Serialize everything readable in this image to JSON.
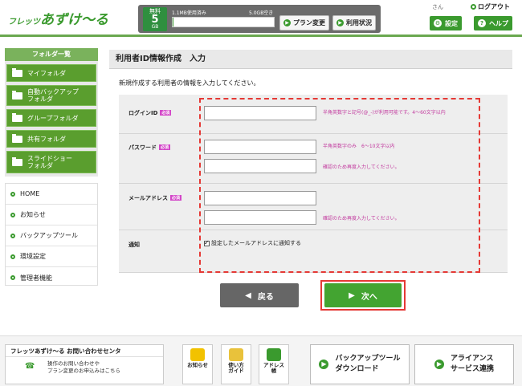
{
  "header": {
    "logo_small": "フレッツ",
    "logo_large": "あずけ〜る",
    "plan_badge": {
      "line1": "無料",
      "line2": "5",
      "line3": "GB"
    },
    "usage_used": "1.1MB使用済み",
    "usage_free": "5.0GB空き",
    "usage_fraction": 0.0002,
    "plan_change": "プラン変更",
    "usage_status": "利用状況",
    "user_suffix": "さん",
    "logout": "ログアウト",
    "settings": "設定",
    "help": "ヘルプ"
  },
  "sidebar": {
    "folder_title": "フォルダ一覧",
    "folders": [
      "マイフォルダ",
      "自動バックアップ\nフォルダ",
      "グループフォルダ",
      "共有フォルダ",
      "スライドショー\nフォルダ"
    ],
    "nav": [
      "HOME",
      "お知らせ",
      "バックアップツール",
      "環境設定",
      "管理者機能"
    ]
  },
  "main": {
    "title": "利用者ID情報作成　入力",
    "intro": "新規作成する利用者の情報を入力してください。",
    "fields": {
      "login_label": "ログインID",
      "password_label": "パスワード",
      "email_label": "メールアドレス",
      "notify_label": "通知",
      "required_badge": "必須",
      "login_hint": "半角英数字と記号(@_-)が利用可能です。4〜60文字以内",
      "password_hint": "半角英数字のみ　6〜10文字以内",
      "password_confirm_hint": "確認のため再度入力してください。",
      "email_confirm_hint": "確認のため再度入力してください。",
      "notify_text": "設定したメールアドレスに通知する"
    },
    "back_label": "戻る",
    "next_label": "次へ"
  },
  "footer": {
    "contact_title": "フレッツあずけ〜る お問い合わせセンタ",
    "contact_line1": "操作のお問い合わせや",
    "contact_line2": "プラン変更のお申込みはこちら",
    "tile_news": "お知らせ",
    "tile_guide": "使い方\nガイド",
    "tile_address": "アドレス\n帳",
    "backup_tool_1": "バックアップツール",
    "backup_tool_2": "ダウンロード",
    "alliance_1": "アライアンス",
    "alliance_2": "サービス連携"
  },
  "colors": {
    "brand_green": "#3a9a2e",
    "highlight_red": "#e53935",
    "hint_pink": "#c2399e"
  }
}
